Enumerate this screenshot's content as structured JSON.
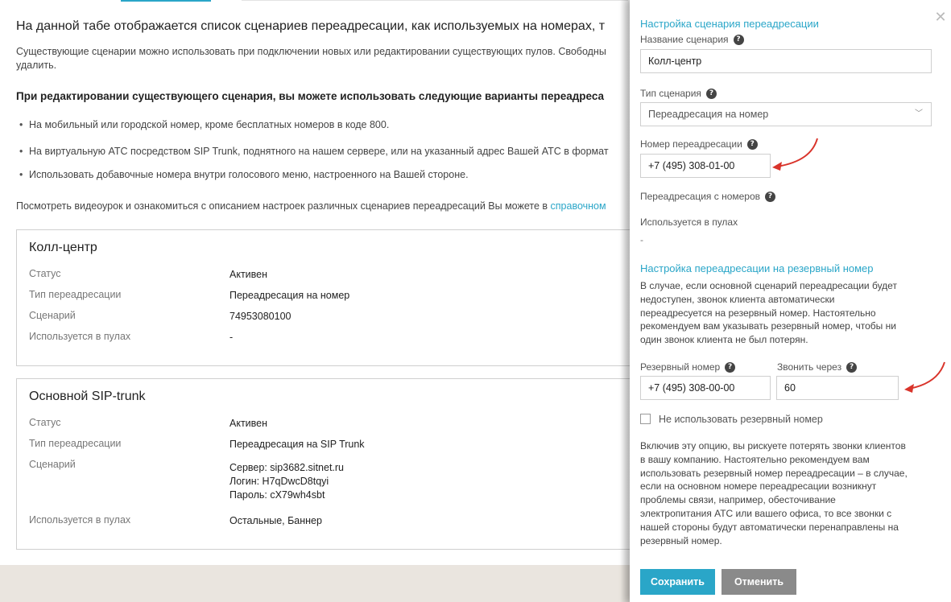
{
  "colors": {
    "accent": "#2aa6c8",
    "arrow": "#d9342b",
    "cancel_button": "#8a8a8a",
    "footer_band": "#eae5df"
  },
  "main": {
    "intro": "На данной табе отображается список сценариев переадресации, как используемых на номерах, т",
    "para_line1": "Существующие сценарии можно использовать при подключении новых или редактировании существующих пулов. Свободны",
    "para_line2": "удалить.",
    "bold_line": "При редактировании существующего сценария, вы можете использовать следующие варианты переадреса",
    "bullets": [
      "На мобильный или городской номер, кроме бесплатных номеров в коде 800.",
      "На виртуальную АТС посредством SIP Trunk, поднятного на нашем сервере, или на указанный адрес Вашей АТС в формат",
      "Использовать добавочные номера внутри голосового меню, настроенного на Вашей стороне."
    ],
    "video_text": "Посмотреть видеоурок и ознакомиться с описанием настроек различных сценариев переадресаций Вы можете в ",
    "video_link": "справочном",
    "cards": [
      {
        "title": "Колл-центр",
        "rows": [
          {
            "label": "Статус",
            "value": "Активен"
          },
          {
            "label": "Тип переадресации",
            "value": "Переадресация на номер"
          },
          {
            "label": "Сценарий",
            "value": "74953080100"
          },
          {
            "label": "Используется в пулах",
            "value": "-"
          }
        ]
      },
      {
        "title": "Основной SIP-trunk",
        "rows": [
          {
            "label": "Статус",
            "value": "Активен"
          },
          {
            "label": "Тип переадресации",
            "value": "Переадресация на SIP Trunk"
          },
          {
            "label": "Сценарий",
            "value_lines": [
              "Сервер: sip3682.sitnet.ru",
              "Логин: H7qDwcD8tqyi",
              "Пароль: cX79wh4sbt"
            ]
          },
          {
            "label": "Используется в пулах",
            "value": "Остальные, Баннер"
          }
        ]
      }
    ]
  },
  "panel": {
    "heading": "Настройка сценария переадресации",
    "name_label": "Название сценария",
    "name_value": "Колл-центр",
    "type_label": "Тип сценария",
    "type_value": "Переадресация на номер",
    "number_label": "Номер переадресации",
    "number_value": "+7 (495) 308-01-00",
    "from_label": "Переадресация с номеров",
    "pools_label": "Используется в пулах",
    "pools_value": "-",
    "backup_heading": "Настройка переадресации на резервный номер",
    "backup_desc": [
      "В случае, если основной сценарий переадресации будет",
      "недоступен, звонок клиента автоматически",
      "переадресуется на резервный номер. Настоятельно",
      "рекомендуем вам указывать резервный номер, чтобы ни",
      "один звонок клиента не был потерян."
    ],
    "backup_number_label": "Резервный номер",
    "backup_number_value": "+7 (495) 308-00-00",
    "call_after_label": "Звонить через",
    "call_after_value": "60",
    "no_backup_label": "Не использовать резервный номер",
    "warning": [
      "Включив эту опцию, вы рискуете потерять звонки клиентов",
      "в вашу компанию. Настоятельно рекомендуем вам",
      "использовать резервный номер переадресации – в случае,",
      "если на основном номере переадресации возникнут",
      "проблемы связи, например, обесточивание",
      "электропитания АТС или вашего офиса, то все звонки с",
      "нашей стороны будут автоматически перенаправлены на",
      "резервный номер."
    ],
    "save_label": "Сохранить",
    "cancel_label": "Отменить",
    "help_glyph": "?",
    "close_glyph": "✕",
    "chevron_glyph": "﹀"
  }
}
